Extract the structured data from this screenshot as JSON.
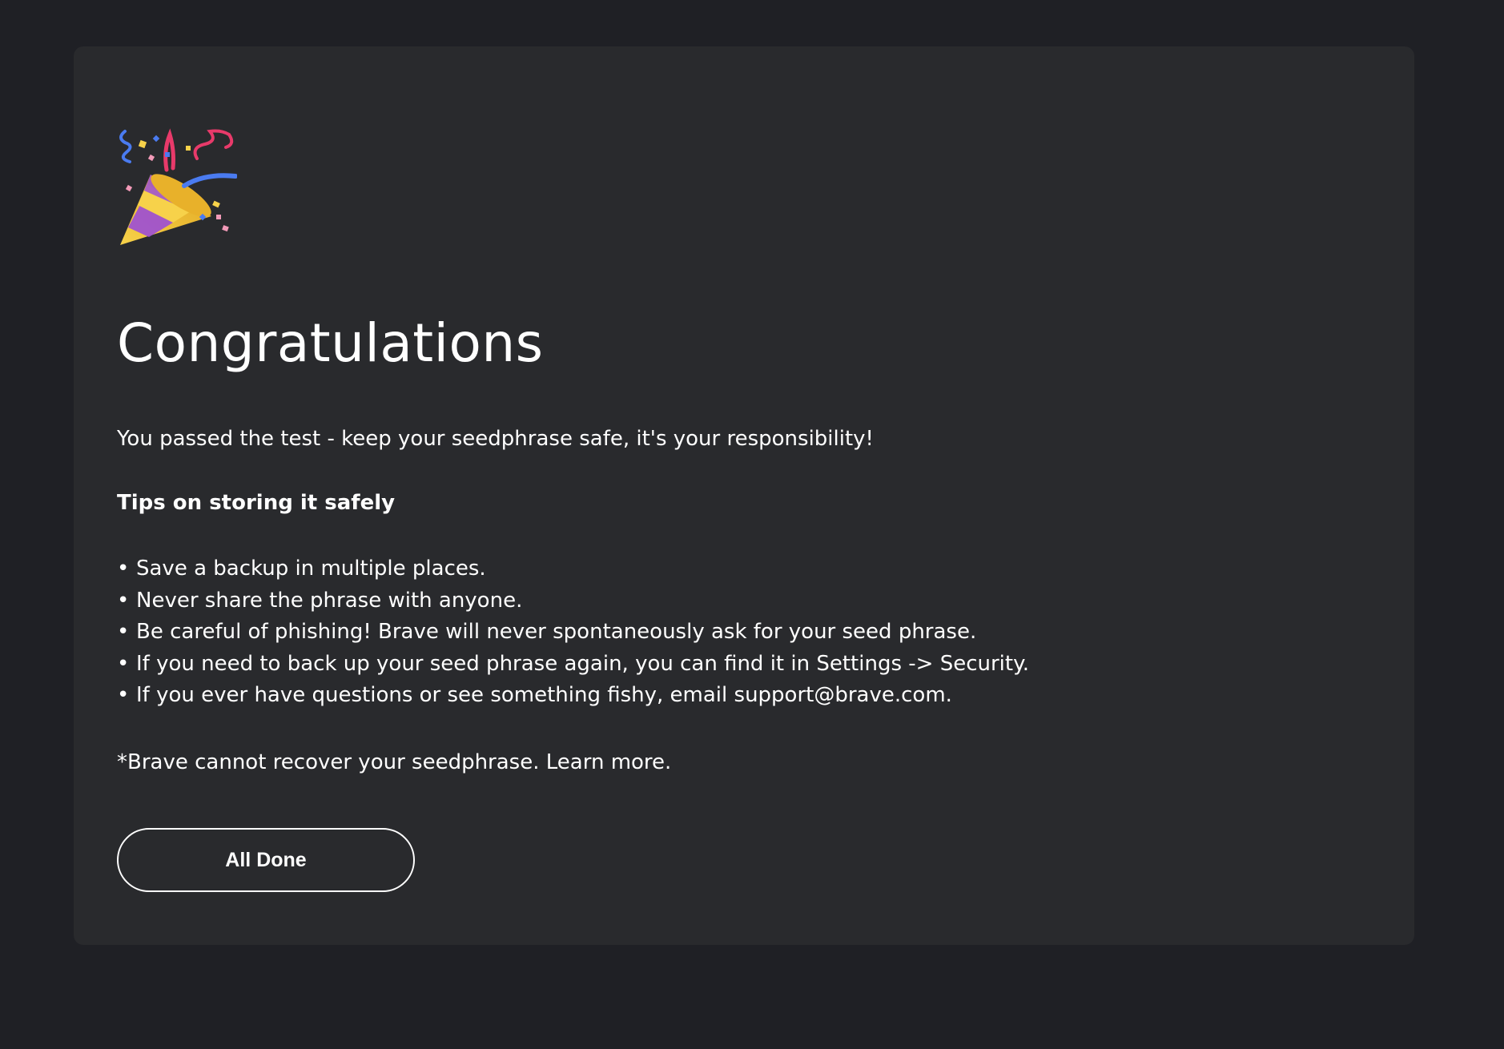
{
  "backup_complete": {
    "icon": "party-popper-icon",
    "title": "Congratulations",
    "subtitle": "You passed the test - keep your seedphrase safe, it's your responsibility!",
    "tips_heading": "Tips on storing it safely",
    "tips": [
      "Save a backup in multiple places.",
      "Never share the phrase with anyone.",
      "Be careful of phishing! Brave will never spontaneously ask for your seed phrase.",
      "If you need to back up your seed phrase again, you can find it in Settings -> Security.",
      "If you ever have questions or see something fishy, email support@brave.com."
    ],
    "bullet": "•",
    "footnote_prefix": "*Brave cannot recover your seedphrase.",
    "learn_more": "Learn more.",
    "done_button": "All Done"
  },
  "colors": {
    "background": "#1f2025",
    "card": "#292a2d",
    "text": "#ffffff"
  }
}
